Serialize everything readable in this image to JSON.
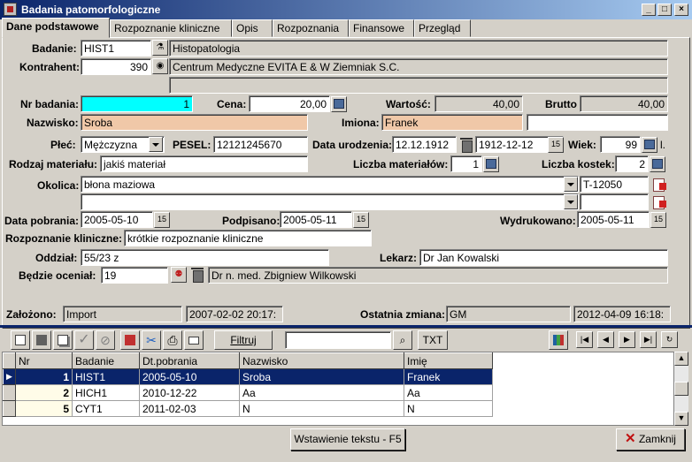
{
  "window": {
    "title": "Badania patomorfologiczne",
    "controls": [
      "_",
      "□",
      "×"
    ]
  },
  "tabs": [
    {
      "label": "Dane podstawowe",
      "active": true
    },
    {
      "label": "Rozpoznanie kliniczne",
      "active": false
    },
    {
      "label": "Opis",
      "active": false
    },
    {
      "label": "Rozpoznania",
      "active": false
    },
    {
      "label": "Finansowe",
      "active": false
    },
    {
      "label": "Przegląd",
      "active": false
    }
  ],
  "form": {
    "badanie": {
      "label": "Badanie:",
      "code": "HIST1",
      "name": "Histopatologia"
    },
    "kontrahent": {
      "label": "Kontrahent:",
      "id": "390",
      "name": "Centrum Medyczne EVITA E & W Ziemniak S.C."
    },
    "nr_badania": {
      "label": "Nr badania:",
      "value": "1"
    },
    "cena": {
      "label": "Cena:",
      "value": "20,00"
    },
    "wartosc": {
      "label": "Wartość:",
      "value": "40,00"
    },
    "brutto": {
      "label": "Brutto",
      "value": "40,00"
    },
    "nazwisko": {
      "label": "Nazwisko:",
      "value": "Sroba"
    },
    "imiona": {
      "label": "Imiona:",
      "value": "Franek",
      "extra": ""
    },
    "plec": {
      "label": "Płeć:",
      "value": "Mężczyzna"
    },
    "pesel": {
      "label": "PESEL:",
      "value": "12121245670"
    },
    "data_urodzenia": {
      "label": "Data urodzenia:",
      "value": "12.12.1912",
      "value2": "1912-12-12"
    },
    "wiek": {
      "label": "Wiek:",
      "value": "99",
      "unit": "l."
    },
    "rodzaj_materialu": {
      "label": "Rodzaj materiału:",
      "value": "jakiś materiał"
    },
    "liczba_materialow": {
      "label": "Liczba materiałów:",
      "value": "1"
    },
    "liczba_kostek": {
      "label": "Liczba kostek:",
      "value": "2"
    },
    "okolica": {
      "label": "Okolica:",
      "value": "błona maziowa",
      "code": "T-12050",
      "value2": "",
      "code2": ""
    },
    "data_pobrania": {
      "label": "Data pobrania:",
      "value": "2005-05-10"
    },
    "podpisano": {
      "label": "Podpisano:",
      "value": "2005-05-11"
    },
    "wydrukowano": {
      "label": "Wydrukowano:",
      "value": "2005-05-11"
    },
    "rozpoznanie_kliniczne": {
      "label": "Rozpoznanie kliniczne:",
      "value": "krótkie rozpoznanie kliniczne"
    },
    "oddzial": {
      "label": "Oddział:",
      "value": "55/23 z"
    },
    "lekarz": {
      "label": "Lekarz:",
      "value": "Dr Jan Kowalski"
    },
    "bedzie_ocenial": {
      "label": "Będzie oceniał:",
      "id": "19",
      "name": "Dr n. med. Zbigniew Wilkowski"
    }
  },
  "status": {
    "zalozono_label": "Założono:",
    "zalozono_by": "Import",
    "zalozono_at": "2007-02-02 20:17:",
    "zmiana_label": "Ostatnia zmiana:",
    "zmiana_by": "GM",
    "zmiana_at": "2012-04-09 16:18:"
  },
  "toolbar": {
    "filter_label": "Filtruj",
    "search_value": "",
    "txt_label": "TXT"
  },
  "table": {
    "columns": [
      "Nr",
      "Badanie",
      "Dt.pobrania",
      "Nazwisko",
      "Imię"
    ],
    "rows": [
      {
        "nr": "1",
        "badanie": "HIST1",
        "dt": "2005-05-10",
        "nazwisko": "Sroba",
        "imie": "Franek",
        "selected": true
      },
      {
        "nr": "2",
        "badanie": "HICH1",
        "dt": "2010-12-22",
        "nazwisko": "Aa",
        "imie": "Aa",
        "selected": false
      },
      {
        "nr": "5",
        "badanie": "CYT1",
        "dt": "2011-02-03",
        "nazwisko": "N",
        "imie": "N",
        "selected": false
      }
    ]
  },
  "footer": {
    "insert_text_label": "Wstawienie tekstu - F5",
    "close_label": "Zamknij"
  },
  "colors": {
    "titlebar": "#0a246a",
    "highlight_cyan": "#00ffff",
    "highlight_peach": "#f0c8a8",
    "selection": "#0a246a"
  }
}
